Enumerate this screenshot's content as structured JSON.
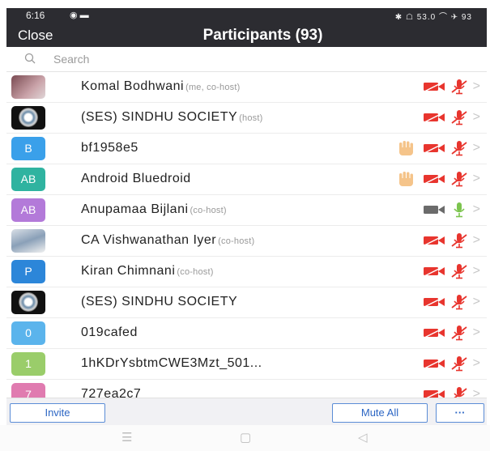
{
  "status": {
    "time": "6:16",
    "icons_left": "◉ ▬",
    "icons_right": "✱ ☖ 53.0 ⌒ ✈ 93"
  },
  "header": {
    "close_label": "Close",
    "title": "Participants (93)"
  },
  "search": {
    "placeholder": "Search"
  },
  "participants": [
    {
      "name": "Komal Bodhwani",
      "role": "(me, co-host)",
      "avatar": "photo",
      "avatar_text": "",
      "avatar_color": "",
      "hand": false,
      "video": "off",
      "audio": "off"
    },
    {
      "name": "(SES) SINDHU SOCIETY",
      "role": "(host)",
      "avatar": "logo",
      "avatar_text": "",
      "avatar_color": "",
      "hand": false,
      "video": "off",
      "audio": "off"
    },
    {
      "name": "bf1958e5",
      "role": "",
      "avatar": "letter",
      "avatar_text": "B",
      "avatar_color": "#3aa0ea",
      "hand": true,
      "video": "off",
      "audio": "off"
    },
    {
      "name": "Android Bluedroid",
      "role": "",
      "avatar": "letter",
      "avatar_text": "AB",
      "avatar_color": "#2fb3a0",
      "hand": true,
      "video": "off",
      "audio": "off"
    },
    {
      "name": "Anupamaa Bijlani",
      "role": "(co-host)",
      "avatar": "letter",
      "avatar_text": "AB",
      "avatar_color": "#b37ad9",
      "hand": false,
      "video": "on",
      "audio": "on"
    },
    {
      "name": "CA Vishwanathan Iyer",
      "role": "(co-host)",
      "avatar": "cap",
      "avatar_text": "",
      "avatar_color": "",
      "hand": false,
      "video": "off",
      "audio": "off"
    },
    {
      "name": "Kiran Chimnani",
      "role": "(co-host)",
      "avatar": "letter",
      "avatar_text": "P",
      "avatar_color": "#2c86d9",
      "hand": false,
      "video": "off",
      "audio": "off"
    },
    {
      "name": "(SES) SINDHU SOCIETY",
      "role": "",
      "avatar": "logo",
      "avatar_text": "",
      "avatar_color": "",
      "hand": false,
      "video": "off",
      "audio": "off"
    },
    {
      "name": "019cafed",
      "role": "",
      "avatar": "letter",
      "avatar_text": "0",
      "avatar_color": "#5bb4ec",
      "hand": false,
      "video": "off",
      "audio": "off"
    },
    {
      "name": "1hKDrYsbtmCWE3Mzt_501...",
      "role": "",
      "avatar": "letter",
      "avatar_text": "1",
      "avatar_color": "#9acd6a",
      "hand": false,
      "video": "off",
      "audio": "off"
    },
    {
      "name": "727ea2c7",
      "role": "",
      "avatar": "letter",
      "avatar_text": "7",
      "avatar_color": "#e07bb0",
      "hand": false,
      "video": "off",
      "audio": "off"
    }
  ],
  "footer": {
    "invite_label": "Invite",
    "mute_all_label": "Mute All",
    "more_label": "···"
  },
  "colors": {
    "header_bg": "#2c2c31",
    "muted_red": "#e8352e",
    "hand_skin": "#f5c48a",
    "accent_blue": "#2c66c4"
  }
}
